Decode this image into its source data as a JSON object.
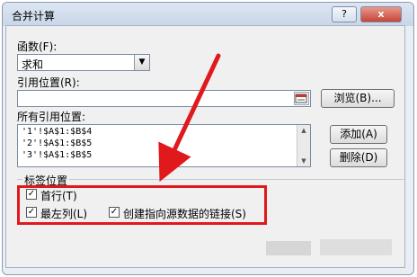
{
  "window": {
    "title": "合并计算",
    "help_label": "?",
    "close_label": "x"
  },
  "function": {
    "label": "函数(F):",
    "selected": "求和"
  },
  "reference": {
    "label": "引用位置(R):",
    "value": "",
    "browse_label": "浏览(B)..."
  },
  "all_references": {
    "label": "所有引用位置:",
    "items": [
      "'1'!$A$1:$B$4",
      "'2'!$A$1:$B$5",
      "'3'!$A$1:$B$5"
    ],
    "add_label": "添加(A)",
    "delete_label": "删除(D)"
  },
  "labels_group": {
    "title": "标签位置",
    "top_row": {
      "label": "首行(T)",
      "checked": true
    },
    "left_column": {
      "label": "最左列(L)",
      "checked": true
    },
    "link_source": {
      "label": "创建指向源数据的链接(S)",
      "checked": true
    }
  },
  "annotation": {
    "box_color": "#e0191d",
    "arrow_color": "#e0191d"
  }
}
